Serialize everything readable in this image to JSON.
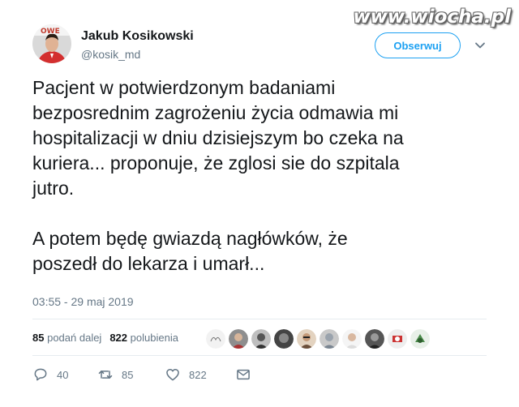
{
  "watermark": "www.wiocha.pl",
  "user": {
    "display_name": "Jakub Kosikowski",
    "handle": "@kosik_md"
  },
  "follow_button": "Obserwuj",
  "tweet": {
    "paragraph1": "Pacjent w potwierdzonym badaniami\nbezposrednim zagrożeniu życia odmawia mi\nhospitalizacji w dniu dzisiejszym bo czeka na\nkuriera... proponuje, że zglosi sie do szpitala\njutro.",
    "paragraph2": "A potem będę gwiazdą nagłówków, że\nposzedł do lekarza i umarł..."
  },
  "timestamp": "03:55 - 29 maj 2019",
  "stats": {
    "retweets_count": "85",
    "retweets_label": "podań dalej",
    "likes_count": "822",
    "likes_label": "polubienia"
  },
  "actions": {
    "replies": "40",
    "retweets": "85",
    "likes": "822"
  },
  "colors": {
    "accent": "#1da1f2",
    "secondary_text": "#657786",
    "divider": "#e6ecf0"
  }
}
